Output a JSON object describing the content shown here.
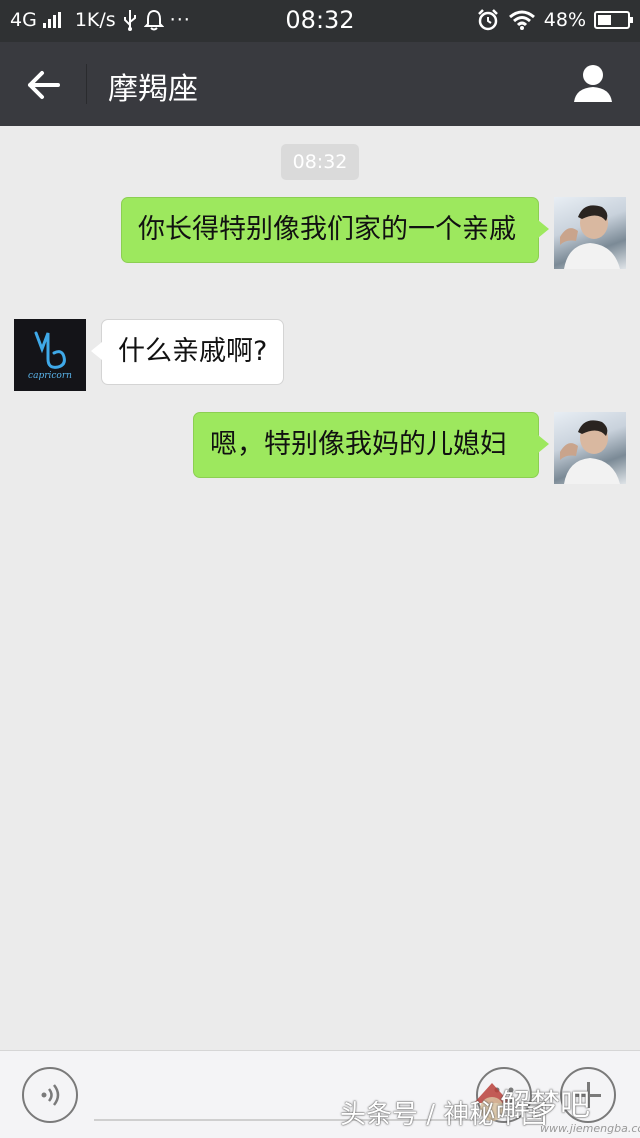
{
  "status_bar": {
    "network": "4G",
    "speed": "1K/s",
    "time": "08:32",
    "battery": "48%",
    "battery_level": 0.48
  },
  "nav": {
    "title": "摩羯座",
    "back_icon": "arrow-left-icon",
    "profile_icon": "person-icon"
  },
  "chat": {
    "timestamp": "08:32",
    "messages": [
      {
        "side": "out",
        "text": "你长得特别像我们家的一个亲戚"
      },
      {
        "side": "in",
        "text": "什么亲戚啊?"
      },
      {
        "side": "out",
        "text": "嗯，特别像我妈的儿媳妇"
      }
    ],
    "contact_avatar_text": "capricorn"
  },
  "input_bar": {
    "voice_icon": "voice-icon",
    "emoji_icon": "emoji-icon",
    "plus_icon": "plus-icon"
  },
  "watermarks": {
    "line1": "头条号 / 神秘中国",
    "line2": "解梦吧",
    "line3": "www.jiemengba.com"
  },
  "colors": {
    "outgoing_bubble": "#9de85e",
    "incoming_bubble": "#ffffff",
    "nav_background": "#393a3f",
    "chat_background": "#ebebeb"
  }
}
